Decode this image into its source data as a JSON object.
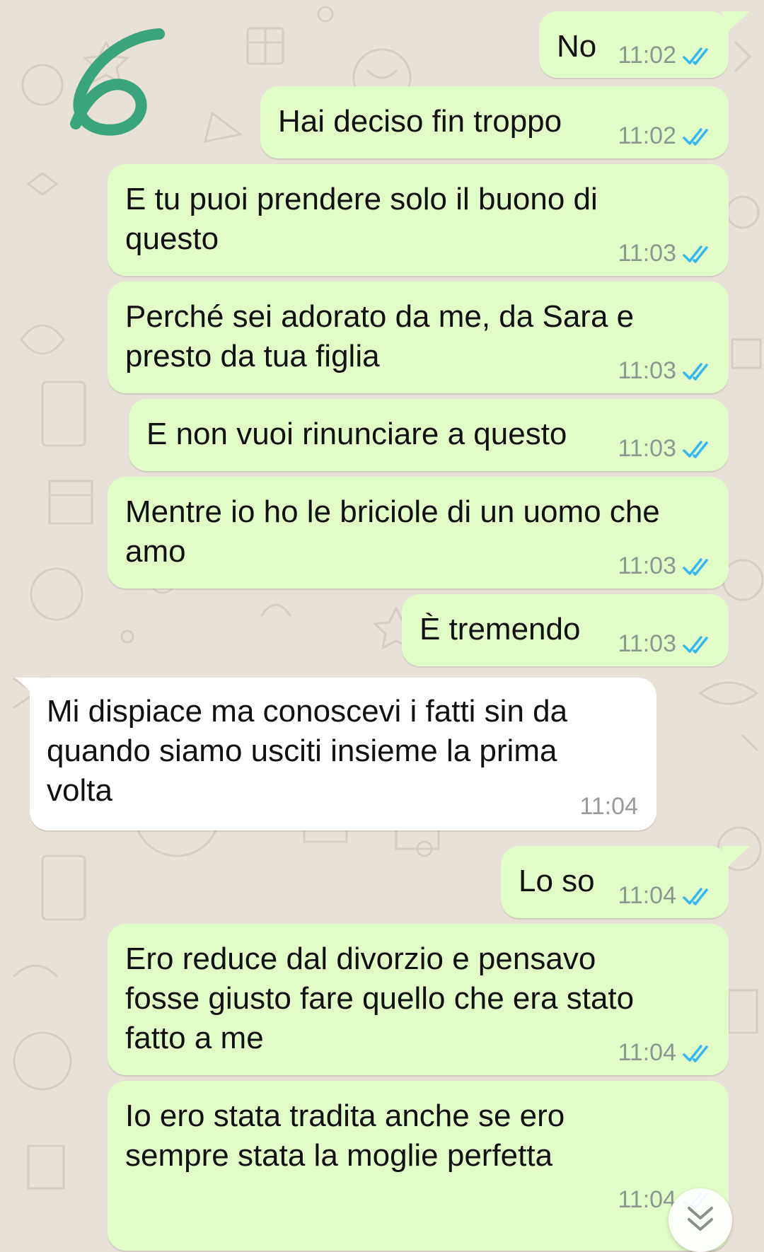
{
  "messages": [
    {
      "direction": "out",
      "text": "No",
      "time": "11:02",
      "status": "read"
    },
    {
      "direction": "out",
      "text": "Hai deciso fin troppo",
      "time": "11:02",
      "status": "read"
    },
    {
      "direction": "out",
      "text": "E tu puoi prendere solo il buono di\nquesto",
      "time": "11:03",
      "status": "read"
    },
    {
      "direction": "out",
      "text": "Perché sei adorato da me, da Sara e\npresto da tua figlia",
      "time": "11:03",
      "status": "read"
    },
    {
      "direction": "out",
      "text": "E non vuoi rinunciare a questo",
      "time": "11:03",
      "status": "read"
    },
    {
      "direction": "out",
      "text": "Mentre io ho le briciole di un uomo che\namo",
      "time": "11:03",
      "status": "read"
    },
    {
      "direction": "out",
      "text": "È tremendo",
      "time": "11:03",
      "status": "read"
    },
    {
      "direction": "in",
      "text": "Mi dispiace ma conoscevi i fatti sin da\nquando siamo usciti insieme la prima\nvolta",
      "time": "11:04"
    },
    {
      "direction": "out",
      "text": "Lo so",
      "time": "11:04",
      "status": "read"
    },
    {
      "direction": "out",
      "text": "Ero reduce dal divorzio e pensavo\nfosse giusto fare quello che era stato\nfatto a me",
      "time": "11:04",
      "status": "read"
    },
    {
      "direction": "out",
      "text": "Io ero stata tradita anche se ero\nsempre stata la moglie perfetta",
      "time": "11:04",
      "status": "read"
    }
  ],
  "colors": {
    "wallpaper": "#e8e1d7",
    "outgoing_bubble": "#e2fcc8",
    "incoming_bubble": "#ffffff",
    "read_ticks": "#34b7f1",
    "handwritten_annotation": "#3aa57c"
  },
  "icons": {
    "read_status": "double-check-icon",
    "scroll_down": "double-chevron-down-icon"
  }
}
